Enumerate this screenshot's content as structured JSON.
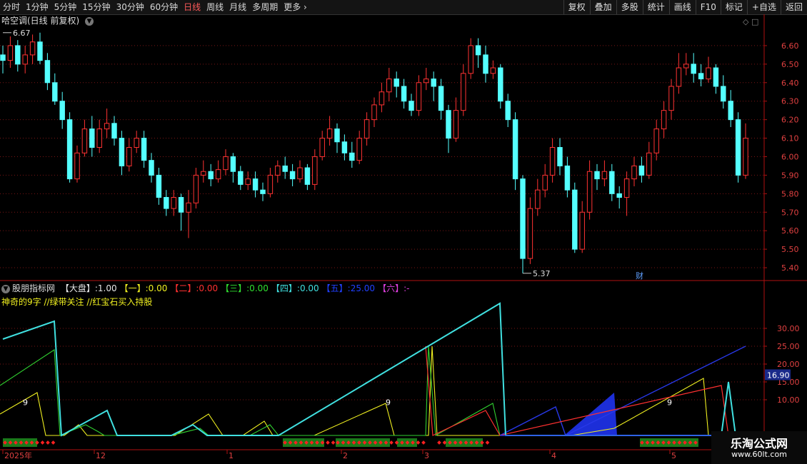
{
  "toolbar": {
    "periods": [
      "分时",
      "1分钟",
      "5分钟",
      "15分钟",
      "30分钟",
      "60分钟",
      "日线",
      "周线",
      "月线",
      "多周期",
      "更多"
    ],
    "active_period": "日线",
    "right_buttons": [
      "复权",
      "叠加",
      "多股",
      "统计",
      "画线",
      "F10",
      "标记",
      "+自选",
      "返回"
    ]
  },
  "main_chart": {
    "title": "哈空调(日线 前复权)",
    "high_label": "6.67",
    "low_label": "5.37",
    "event_label": "财",
    "y_ticks": [
      "6.60",
      "6.50",
      "6.40",
      "6.30",
      "6.20",
      "6.10",
      "6.00",
      "5.90",
      "5.80",
      "5.70",
      "5.60",
      "5.50",
      "5.40"
    ]
  },
  "indicator": {
    "name": "股朋指标网",
    "items": [
      {
        "label": "【大盘】",
        "value": "1.00",
        "color": "#e8e8e8"
      },
      {
        "label": "【一】",
        "value": "0.00",
        "color": "#f0f020"
      },
      {
        "label": "【二】",
        "value": "0.00",
        "color": "#ff3030"
      },
      {
        "label": "【三】",
        "value": "0.00",
        "color": "#30e030"
      },
      {
        "label": "【四】",
        "value": "0.00",
        "color": "#40e0e0"
      },
      {
        "label": "【五】",
        "value": "25.00",
        "color": "#2040ff"
      },
      {
        "label": "【六】",
        "value": "-",
        "color": "#e040e0"
      }
    ],
    "subtitle": "神奇的9字 //绿带关注 //红宝石买入持股",
    "y_ticks": [
      "30.00",
      "25.00",
      "20.00",
      "15.00",
      "10.00"
    ],
    "current_value": "16.90",
    "nine_label": "9"
  },
  "x_axis": {
    "labels": [
      "2025年",
      "12",
      "1",
      "2",
      "3",
      "4",
      "5"
    ]
  },
  "watermark": {
    "title": "乐淘公式网",
    "url": "www.60lt.com"
  },
  "colors": {
    "up": "#ff3232",
    "down": "#54ffff",
    "grid": "#7a1515",
    "axis": "#b01010"
  },
  "chart_data": {
    "type": "candlestick",
    "title": "哈空调(日线 前复权)",
    "ylim": [
      5.35,
      6.7
    ],
    "high": 6.67,
    "low": 5.37,
    "candles": [
      [
        6.55,
        6.52,
        6.6,
        6.45
      ],
      [
        6.52,
        6.6,
        6.65,
        6.48
      ],
      [
        6.6,
        6.5,
        6.63,
        6.46
      ],
      [
        6.5,
        6.55,
        6.6,
        6.45
      ],
      [
        6.55,
        6.62,
        6.66,
        6.5
      ],
      [
        6.62,
        6.52,
        6.67,
        6.5
      ],
      [
        6.52,
        6.4,
        6.56,
        6.36
      ],
      [
        6.4,
        6.3,
        6.45,
        6.28
      ],
      [
        6.3,
        6.2,
        6.35,
        6.15
      ],
      [
        6.2,
        5.88,
        6.24,
        5.86
      ],
      [
        5.88,
        6.02,
        6.06,
        5.86
      ],
      [
        6.02,
        6.15,
        6.2,
        6.0
      ],
      [
        6.15,
        6.05,
        6.22,
        6.0
      ],
      [
        6.05,
        6.15,
        6.2,
        6.02
      ],
      [
        6.15,
        6.18,
        6.26,
        6.1
      ],
      [
        6.18,
        6.1,
        6.22,
        6.06
      ],
      [
        6.1,
        5.95,
        6.14,
        5.9
      ],
      [
        5.95,
        6.05,
        6.1,
        5.92
      ],
      [
        6.05,
        6.1,
        6.14,
        6.02
      ],
      [
        6.1,
        5.98,
        6.14,
        5.94
      ],
      [
        5.98,
        5.9,
        6.02,
        5.86
      ],
      [
        5.9,
        5.78,
        5.94,
        5.74
      ],
      [
        5.78,
        5.72,
        5.82,
        5.68
      ],
      [
        5.72,
        5.78,
        5.82,
        5.68
      ],
      [
        5.78,
        5.7,
        5.8,
        5.6
      ],
      [
        5.7,
        5.75,
        5.82,
        5.56
      ],
      [
        5.75,
        5.9,
        5.94,
        5.72
      ],
      [
        5.9,
        5.92,
        5.98,
        5.86
      ],
      [
        5.92,
        5.88,
        5.96,
        5.84
      ],
      [
        5.88,
        5.93,
        5.98,
        5.86
      ],
      [
        5.93,
        6.0,
        6.04,
        5.9
      ],
      [
        6.0,
        5.92,
        6.02,
        5.86
      ],
      [
        5.92,
        5.85,
        5.95,
        5.82
      ],
      [
        5.85,
        5.88,
        5.92,
        5.82
      ],
      [
        5.88,
        5.82,
        5.92,
        5.78
      ],
      [
        5.82,
        5.8,
        5.86,
        5.76
      ],
      [
        5.8,
        5.9,
        5.94,
        5.78
      ],
      [
        5.9,
        5.95,
        5.98,
        5.86
      ],
      [
        5.95,
        5.92,
        6.0,
        5.88
      ],
      [
        5.92,
        5.88,
        5.96,
        5.84
      ],
      [
        5.88,
        5.94,
        5.98,
        5.86
      ],
      [
        5.94,
        5.85,
        5.96,
        5.82
      ],
      [
        5.85,
        6.0,
        6.04,
        5.82
      ],
      [
        6.0,
        6.1,
        6.14,
        5.98
      ],
      [
        6.1,
        6.15,
        6.22,
        6.06
      ],
      [
        6.15,
        6.08,
        6.18,
        6.02
      ],
      [
        6.08,
        6.02,
        6.12,
        5.98
      ],
      [
        6.02,
        5.98,
        6.08,
        5.94
      ],
      [
        5.98,
        6.1,
        6.14,
        5.96
      ],
      [
        6.1,
        6.2,
        6.24,
        6.06
      ],
      [
        6.2,
        6.28,
        6.32,
        6.16
      ],
      [
        6.28,
        6.35,
        6.4,
        6.24
      ],
      [
        6.35,
        6.42,
        6.48,
        6.3
      ],
      [
        6.42,
        6.38,
        6.46,
        6.32
      ],
      [
        6.38,
        6.3,
        6.42,
        6.26
      ],
      [
        6.3,
        6.25,
        6.34,
        6.22
      ],
      [
        6.25,
        6.4,
        6.44,
        6.22
      ],
      [
        6.4,
        6.42,
        6.48,
        6.36
      ],
      [
        6.42,
        6.38,
        6.46,
        6.3
      ],
      [
        6.38,
        6.25,
        6.42,
        6.2
      ],
      [
        6.25,
        6.1,
        6.28,
        6.02
      ],
      [
        6.1,
        6.25,
        6.32,
        6.08
      ],
      [
        6.25,
        6.45,
        6.5,
        6.22
      ],
      [
        6.45,
        6.6,
        6.64,
        6.42
      ],
      [
        6.6,
        6.55,
        6.64,
        6.48
      ],
      [
        6.55,
        6.45,
        6.6,
        6.4
      ],
      [
        6.45,
        6.48,
        6.52,
        6.42
      ],
      [
        6.48,
        6.3,
        6.5,
        6.26
      ],
      [
        6.3,
        6.2,
        6.34,
        6.16
      ],
      [
        6.2,
        5.88,
        6.24,
        5.82
      ],
      [
        5.88,
        5.45,
        5.9,
        5.37
      ],
      [
        5.45,
        5.72,
        5.78,
        5.42
      ],
      [
        5.72,
        5.82,
        5.88,
        5.68
      ],
      [
        5.82,
        5.9,
        5.96,
        5.78
      ],
      [
        5.9,
        6.05,
        6.1,
        5.86
      ],
      [
        6.05,
        5.95,
        6.1,
        5.9
      ],
      [
        5.95,
        5.82,
        6.0,
        5.78
      ],
      [
        5.82,
        5.5,
        5.86,
        5.48
      ],
      [
        5.5,
        5.7,
        5.76,
        5.48
      ],
      [
        5.7,
        5.92,
        5.98,
        5.66
      ],
      [
        5.92,
        5.88,
        5.96,
        5.82
      ],
      [
        5.88,
        5.92,
        5.98,
        5.84
      ],
      [
        5.92,
        5.8,
        5.96,
        5.76
      ],
      [
        5.8,
        5.78,
        5.84,
        5.72
      ],
      [
        5.78,
        5.88,
        5.92,
        5.68
      ],
      [
        5.88,
        5.95,
        6.0,
        5.84
      ],
      [
        5.95,
        5.9,
        6.0,
        5.86
      ],
      [
        5.9,
        6.02,
        6.08,
        5.88
      ],
      [
        6.02,
        6.15,
        6.2,
        5.98
      ],
      [
        6.15,
        6.25,
        6.3,
        6.1
      ],
      [
        6.25,
        6.38,
        6.42,
        6.2
      ],
      [
        6.38,
        6.48,
        6.56,
        6.34
      ],
      [
        6.48,
        6.5,
        6.56,
        6.44
      ],
      [
        6.5,
        6.45,
        6.56,
        6.4
      ],
      [
        6.45,
        6.42,
        6.5,
        6.38
      ],
      [
        6.42,
        6.48,
        6.54,
        6.4
      ],
      [
        6.48,
        6.38,
        6.5,
        6.34
      ],
      [
        6.38,
        6.3,
        6.44,
        6.26
      ],
      [
        6.3,
        6.2,
        6.36,
        6.16
      ],
      [
        6.2,
        5.9,
        6.24,
        5.86
      ],
      [
        5.9,
        6.1,
        6.18,
        5.88
      ]
    ]
  }
}
